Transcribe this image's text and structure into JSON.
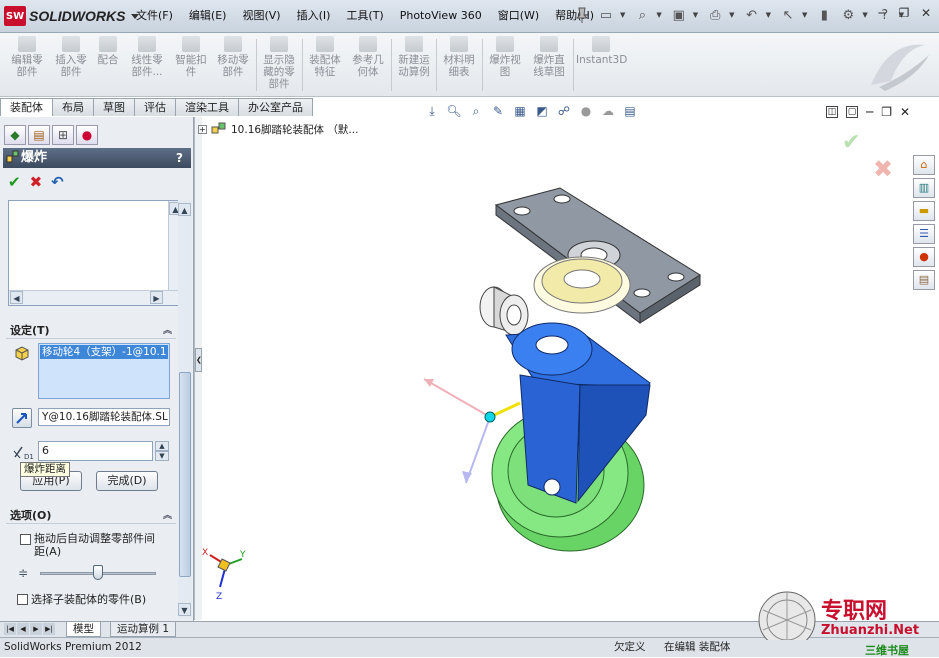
{
  "app": {
    "logo_text": "SOLIDWORKS",
    "logo_badge": "SW"
  },
  "menu": [
    "文件(F)",
    "编辑(E)",
    "视图(V)",
    "插入(I)",
    "工具(T)",
    "PhotoView 360",
    "窗口(W)",
    "帮助(H)"
  ],
  "ribbon": [
    {
      "label": "编辑零\n部件"
    },
    {
      "label": "插入零\n部件"
    },
    {
      "label": "配合"
    },
    {
      "label": "线性零\n部件..."
    },
    {
      "label": "智能扣\n件"
    },
    {
      "label": "移动零\n部件"
    },
    {
      "label": "显示隐\n藏的零\n部件"
    },
    {
      "label": "装配体\n特征"
    },
    {
      "label": "参考几\n何体"
    },
    {
      "label": "新建运\n动算例"
    },
    {
      "label": "材料明\n细表"
    },
    {
      "label": "爆炸视\n图"
    },
    {
      "label": "爆炸直\n线草图"
    },
    {
      "label": "Instant3D"
    }
  ],
  "cmd_tabs": [
    "装配体",
    "布局",
    "草图",
    "评估",
    "渲染工具",
    "办公室产品"
  ],
  "panel": {
    "title": "爆炸",
    "help": "?",
    "settings_header": "设定(T)",
    "selected_item": "移动轮4（支架）-1@10.1",
    "direction_value": "Y@10.16脚踏轮装配体.SL",
    "distance_value": "6",
    "distance_tooltip": "爆炸距离",
    "apply_label": "应用(P)",
    "done_label": "完成(D)",
    "options_header": "选项(O)",
    "option_auto_space": "拖动后自动调整零部件间距(A)",
    "option_select_sub": "选择子装配体的零件(B)"
  },
  "tree": {
    "root_label": "10.16脚踏轮装配体 （默..."
  },
  "bottom_tabs": [
    "模型",
    "运动算例 1"
  ],
  "status": {
    "product": "SolidWorks Premium 2012",
    "under_defined": "欠定义",
    "editing": "在编辑 装配体"
  },
  "triad": {
    "x": "X",
    "y": "Y",
    "z": "Z"
  },
  "watermark": {
    "cn": "专职网",
    "en": "Zhuanzhi.Net",
    "sub": "三维书屋"
  },
  "colors": {
    "wheel": "#7fe07a",
    "bracket": "#2f6fe0",
    "plate": "#9aa3ad",
    "brand_red": "#c8102e"
  }
}
